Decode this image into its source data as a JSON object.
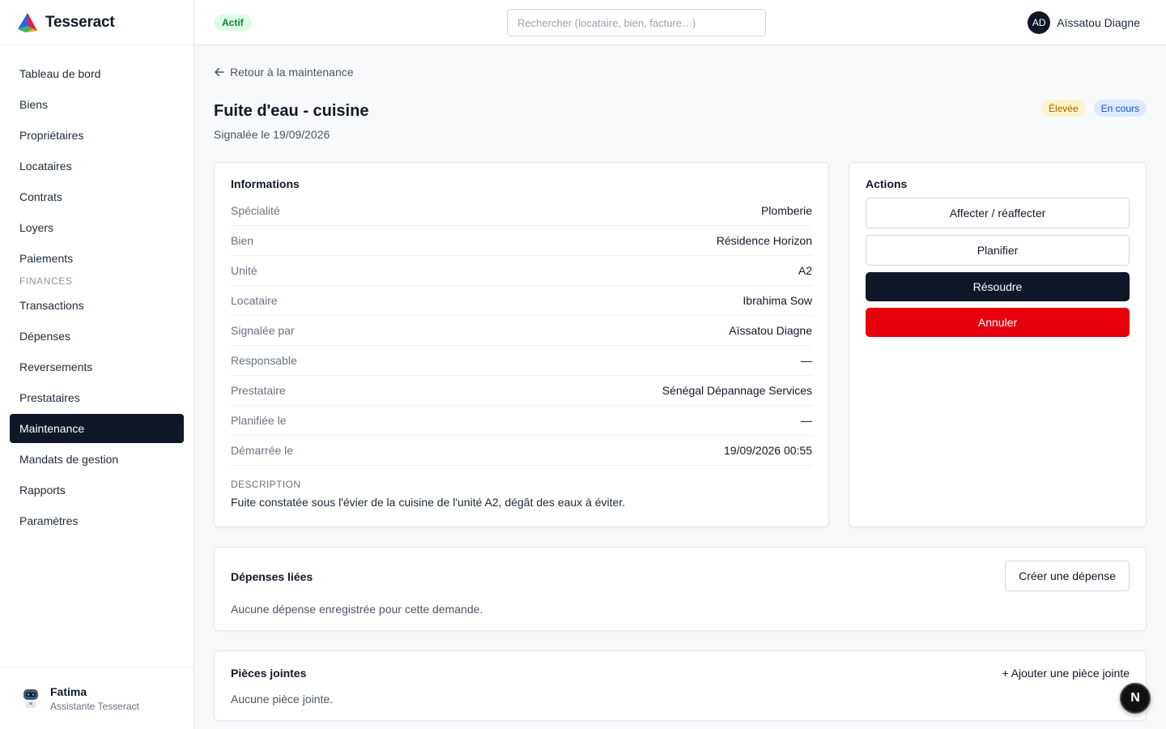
{
  "app": {
    "name": "Tesseract",
    "status_badge": "Actif"
  },
  "search": {
    "placeholder": "Rechercher (locataire, bien, facture…)"
  },
  "user": {
    "initials": "AD",
    "name": "Aïssatou Diagne"
  },
  "sidebar": {
    "items": [
      {
        "label": "Tableau de bord"
      },
      {
        "label": "Biens"
      },
      {
        "label": "Propriétaires"
      },
      {
        "label": "Locataires"
      },
      {
        "label": "Contrats"
      },
      {
        "label": "Loyers"
      },
      {
        "label": "Paiements"
      }
    ],
    "section": "FINANCES",
    "finance_items": [
      {
        "label": "Transactions"
      },
      {
        "label": "Dépenses"
      },
      {
        "label": "Reversements"
      },
      {
        "label": "Prestataires"
      },
      {
        "label": "Maintenance",
        "active": true
      },
      {
        "label": "Mandats de gestion"
      },
      {
        "label": "Rapports"
      },
      {
        "label": "Paramètres"
      }
    ],
    "assistant": {
      "name": "Fatima",
      "role": "Assistante Tesseract"
    }
  },
  "page": {
    "back_label": "Retour à la maintenance",
    "title": "Fuite d'eau - cuisine",
    "subtitle": "Signalée le 19/09/2026",
    "priority": "Élevée",
    "status": "En cours"
  },
  "info": {
    "title": "Informations",
    "rows": [
      {
        "label": "Spécialité",
        "value": "Plomberie"
      },
      {
        "label": "Bien",
        "value": "Résidence Horizon"
      },
      {
        "label": "Unité",
        "value": "A2"
      },
      {
        "label": "Locataire",
        "value": "Ibrahima Sow"
      },
      {
        "label": "Signalée par",
        "value": "Aïssatou Diagne"
      },
      {
        "label": "Responsable",
        "value": "—"
      },
      {
        "label": "Prestataire",
        "value": "Sénégal Dépannage Services"
      },
      {
        "label": "Planifiée le",
        "value": "—"
      },
      {
        "label": "Démarrée le",
        "value": "19/09/2026 00:55"
      }
    ],
    "description_label": "DESCRIPTION",
    "description": "Fuite constatée sous l'évier de la cuisine de l'unité A2, dégât des eaux à éviter."
  },
  "actions": {
    "title": "Actions",
    "assign": "Affecter / réaffecter",
    "schedule": "Planifier",
    "resolve": "Résoudre",
    "cancel": "Annuler"
  },
  "expenses": {
    "title": "Dépenses liées",
    "create_label": "Créer une dépense",
    "empty": "Aucune dépense enregistrée pour cette demande."
  },
  "attachments": {
    "title": "Pièces jointes",
    "add_label": "+ Ajouter une pièce jointe",
    "empty": "Aucune pièce jointe."
  },
  "fab": {
    "label": "N"
  },
  "colors": {
    "primary_dark": "#101828",
    "danger": "#e7000b",
    "active_green": "#15803d",
    "priority_amber": "#a16207",
    "status_blue": "#1d4ed8"
  }
}
